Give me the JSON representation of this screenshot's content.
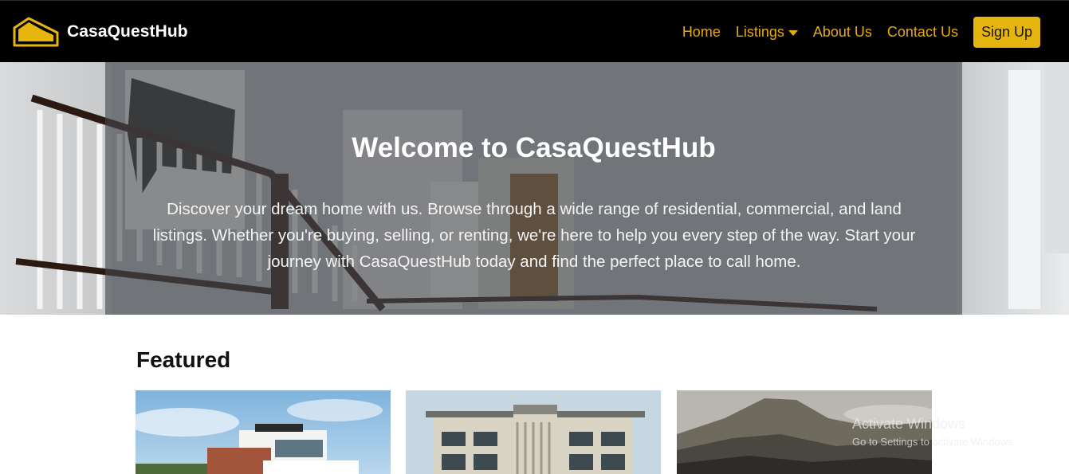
{
  "brand": {
    "name": "CasaQuestHub",
    "logo_icon": "house-logo-icon",
    "accent": "#e6b40f"
  },
  "nav": {
    "items": [
      {
        "label": "Home"
      },
      {
        "label": "Listings",
        "icon": "caret-down-icon"
      },
      {
        "label": "About Us"
      },
      {
        "label": "Contact Us"
      }
    ],
    "signup_label": "Sign Up",
    "link_color": "#e6a817"
  },
  "hero": {
    "title": "Welcome to CasaQuestHub",
    "text": "Discover your dream home with us. Browse through a wide range of residential, commercial, and land listings. Whether you're buying, selling, or renting, we're here to help you every step of the way. Start your journey with CasaQuestHub today and find the perfect place to call home."
  },
  "featured": {
    "title": "Featured",
    "cards": [
      {
        "image": "modern-villa-photo"
      },
      {
        "image": "apartment-building-photo"
      },
      {
        "image": "mountain-landscape-photo"
      }
    ]
  },
  "watermark": {
    "title": "Activate Windows",
    "subtitle": "Go to Settings to activate Windows."
  }
}
